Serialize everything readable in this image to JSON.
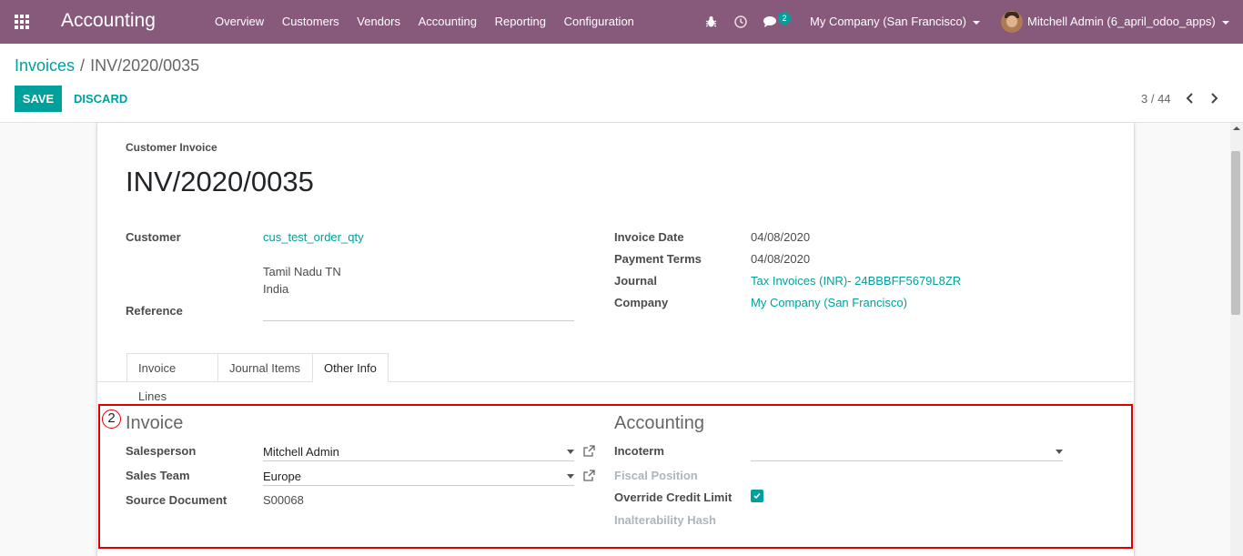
{
  "navbar": {
    "app_title": "Accounting",
    "menu": [
      "Overview",
      "Customers",
      "Vendors",
      "Accounting",
      "Reporting",
      "Configuration"
    ],
    "messages_count": "2",
    "company": "My Company (San Francisco)",
    "user": "Mitchell Admin (6_april_odoo_apps)",
    "icons": [
      "apps-grid-icon",
      "bug-icon",
      "clock-icon",
      "chat-icon"
    ]
  },
  "breadcrumb": {
    "parent": "Invoices",
    "separator": "/",
    "current": "INV/2020/0035"
  },
  "actions": {
    "save": "SAVE",
    "discard": "DISCARD"
  },
  "pager": {
    "value": "3 / 44"
  },
  "invoice": {
    "type_label": "Customer Invoice",
    "number": "INV/2020/0035",
    "customer_label": "Customer",
    "customer": "cus_test_order_qty",
    "address_line1": "Tamil Nadu TN",
    "address_line2": "India",
    "reference_label": "Reference",
    "reference": "",
    "invoice_date_label": "Invoice Date",
    "invoice_date": "04/08/2020",
    "payment_terms_label": "Payment Terms",
    "payment_terms": "04/08/2020",
    "journal_label": "Journal",
    "journal": "Tax Invoices (INR)- 24BBBFF5679L8ZR",
    "company_label": "Company",
    "company": "My Company (San Francisco)"
  },
  "tabs": [
    {
      "label": "Invoice Lines",
      "active": false
    },
    {
      "label": "Journal Items",
      "active": false
    },
    {
      "label": "Other Info",
      "active": true
    }
  ],
  "other_info": {
    "marker": "2",
    "invoice_section": {
      "title": "Invoice",
      "salesperson_label": "Salesperson",
      "salesperson": "Mitchell Admin",
      "sales_team_label": "Sales Team",
      "sales_team": "Europe",
      "source_document_label": "Source Document",
      "source_document": "S00068"
    },
    "accounting_section": {
      "title": "Accounting",
      "incoterm_label": "Incoterm",
      "incoterm": "",
      "fiscal_position_label": "Fiscal Position",
      "override_credit_limit_label": "Override Credit Limit",
      "override_credit_limit": true,
      "inalterability_hash_label": "Inalterability Hash"
    }
  },
  "colors": {
    "navbar": "#875a7b",
    "accent": "#00a09d",
    "highlight_box": "#e00000"
  }
}
